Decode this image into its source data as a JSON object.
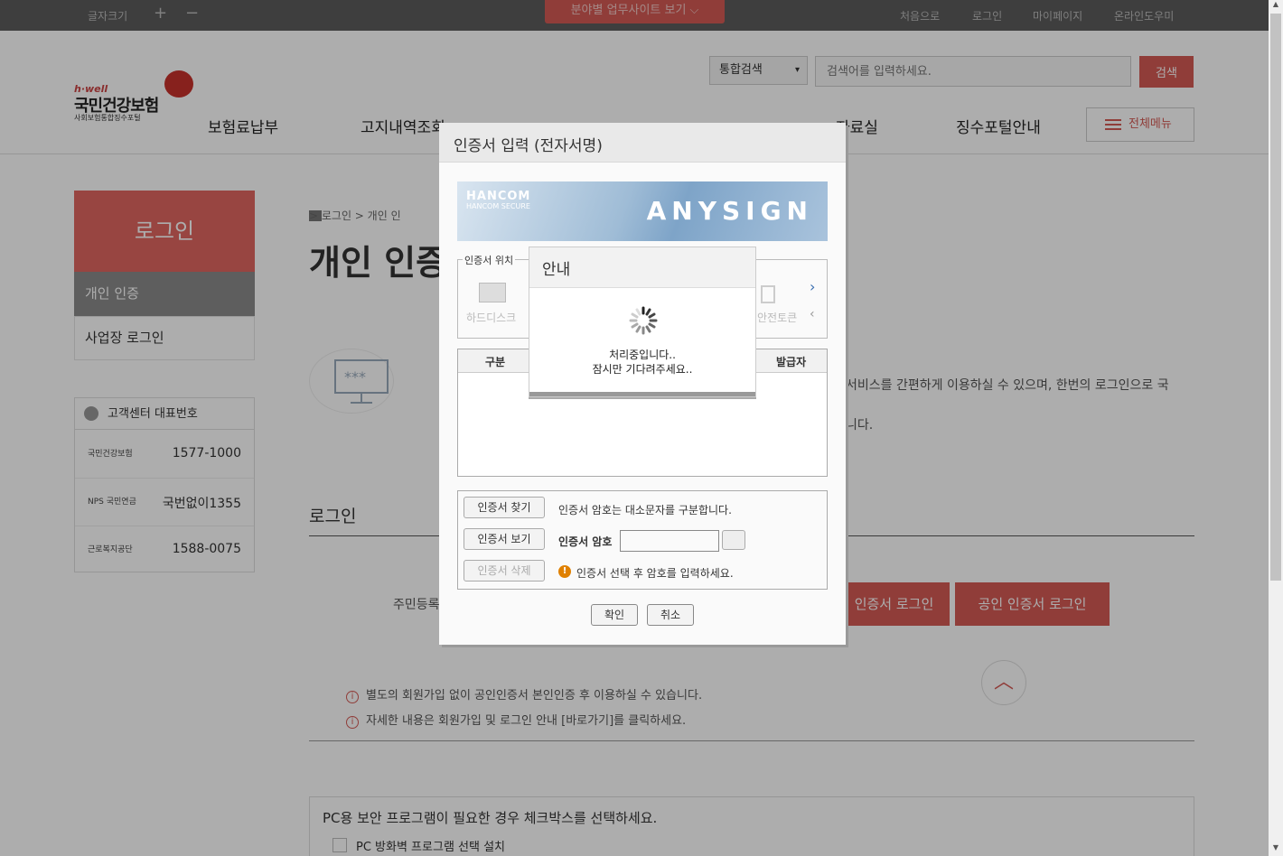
{
  "topbar": {
    "font_size_label": "글자크기",
    "font_plus": "+",
    "font_minus": "−",
    "site_menu": "분야별 업무사이트 보기 ⌵",
    "links": [
      "처음으로",
      "로그인",
      "마이페이지",
      "온라인도우미"
    ]
  },
  "logo": {
    "small": "h·well",
    "big": "국민건강보험",
    "sub": "사회보험통합징수포털"
  },
  "search": {
    "select": "통합검색",
    "select_arrow": "▾",
    "placeholder": "검색어를 입력하세요.",
    "button": "검색"
  },
  "gnb": {
    "items": [
      "보험료납부",
      "고지내역조회",
      "자료실",
      "징수포털안내"
    ],
    "all_menu": "전체메뉴"
  },
  "lnb": {
    "title": "로그인",
    "items": [
      "개인 인증",
      "사업장 로그인"
    ]
  },
  "customer_center": {
    "title": "고객센터 대표번호",
    "rows": [
      {
        "org": "국민건강보험",
        "number": "1577-1000"
      },
      {
        "org": "NPS 국민연금",
        "number": "국번없이1355"
      },
      {
        "org": "근로복지공단",
        "number": "1588-0075"
      }
    ]
  },
  "main": {
    "breadcrumb": "   >  로그인  >  개인 인",
    "title": "개인 인증",
    "intro_line1": "서비스를 간편하게 이용하실 수 있으며, 한번의 로그인으로 국",
    "intro_line2": "니다.",
    "section_title": "로그인",
    "jumin_label": "주민등록",
    "btn_cert1": "인증서 로그인",
    "btn_cert2": "공인 인증서 로그인",
    "top_btn": "︿",
    "notes": [
      "별도의 회원가입 없이 공인인증서 본인인증 후 이용하실 수 있습니다.",
      "자세한 내용은 회원가입 및 로그인 안내 [바로가기]를 클릭하세요."
    ],
    "pc_security_title": "PC용 보안 프로그램이 필요한 경우 체크박스를 선택하세요.",
    "pc_security_option": "PC 방화벽 프로그램 선택 설치"
  },
  "cert_dialog": {
    "title": "인증서 입력 (전자서명)",
    "banner_brand": "HANCOM",
    "banner_sub": "HANCOM SECURE",
    "banner_product": "ANYSIGN",
    "location_label": "인증서 위치",
    "location_hdd": "하드디스크",
    "location_token": "안전토큰",
    "next": "›",
    "prev": "‹",
    "col_kind": "구분",
    "col_issuer": "발급자",
    "btn_find": "인증서 찾기",
    "btn_view": "인증서 보기",
    "btn_delete": "인증서 삭제",
    "case_note": "인증서 암호는 대소문자를 구분합니다.",
    "pw_label": "인증서 암호",
    "warn_icon": "!",
    "warn_text": "인증서 선택 후 암호를 입력하세요.",
    "ok": "확인",
    "cancel": "취소"
  },
  "processing_dialog": {
    "title": "안내",
    "msg1": "처리중입니다..",
    "msg2": "잠시만 기다려주세요.."
  },
  "colors": {
    "accent": "#d45a55",
    "overlay": "rgba(0,0,0,0.32)"
  }
}
